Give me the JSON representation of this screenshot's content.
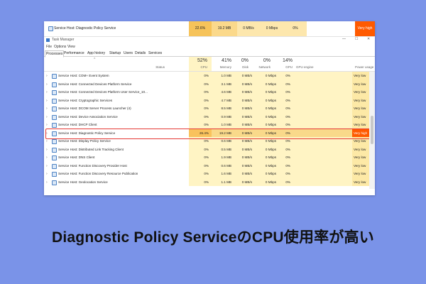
{
  "top_strip": {
    "name": "Service Host: Diagnostic Policy Service",
    "cpu": "22.6%",
    "memory": "19.2 MB",
    "disk": "0 MB/s",
    "network": "0 Mbps",
    "gpu": "0%",
    "power": "Very high"
  },
  "window": {
    "title": "Task Manager",
    "menu": [
      "File",
      "Options",
      "View"
    ],
    "tabs": [
      "Processes",
      "Performance",
      "App history",
      "Startup",
      "Users",
      "Details",
      "Services"
    ],
    "active_tab": "Processes",
    "controls": {
      "minimize": "—",
      "maximize": "☐",
      "close": "✕"
    }
  },
  "header": {
    "cpu_pct": "52%",
    "memory_pct": "41%",
    "disk_pct": "0%",
    "network_pct": "0%",
    "gpu_pct": "14%",
    "labels": {
      "status": "Status",
      "cpu": "CPU",
      "memory": "Memory",
      "disk": "Disk",
      "network": "Network",
      "gpu": "GPU",
      "gpu_engine": "GPU engine",
      "power": "Power usage"
    },
    "sort_arrow": "^"
  },
  "rows": [
    {
      "name": "Service Host: COM+ Event System",
      "cpu": "0%",
      "memory": "1.0 MB",
      "disk": "0 MB/s",
      "network": "0 Mbps",
      "gpu": "0%",
      "power": "Very low"
    },
    {
      "name": "Service Host: Connected Devices Platform Service",
      "cpu": "0%",
      "memory": "3.1 MB",
      "disk": "0 MB/s",
      "network": "0 Mbps",
      "gpu": "0%",
      "power": "Very low"
    },
    {
      "name": "Service Host: Connected Devices Platform User Service_10...",
      "cpu": "0%",
      "memory": "4.6 MB",
      "disk": "0 MB/s",
      "network": "0 Mbps",
      "gpu": "0%",
      "power": "Very low"
    },
    {
      "name": "Service Host: Cryptographic Services",
      "cpu": "0%",
      "memory": "4.7 MB",
      "disk": "0 MB/s",
      "network": "0 Mbps",
      "gpu": "0%",
      "power": "Very low"
    },
    {
      "name": "Service Host: DCOM Server Process Launcher (4)",
      "cpu": "0%",
      "memory": "8.5 MB",
      "disk": "0 MB/s",
      "network": "0 Mbps",
      "gpu": "0%",
      "power": "Very low"
    },
    {
      "name": "Service Host: Device Association Service",
      "cpu": "0%",
      "memory": "0.9 MB",
      "disk": "0 MB/s",
      "network": "0 Mbps",
      "gpu": "0%",
      "power": "Very low"
    },
    {
      "name": "Service Host: DHCP Client",
      "cpu": "0%",
      "memory": "1.0 MB",
      "disk": "0 MB/s",
      "network": "0 Mbps",
      "gpu": "0%",
      "power": "Very low"
    },
    {
      "name": "Service Host: Diagnostic Policy Service",
      "cpu": "26.4%",
      "memory": "19.2 MB",
      "disk": "0 MB/s",
      "network": "0 Mbps",
      "gpu": "0%",
      "power": "Very high",
      "selected": true
    },
    {
      "name": "Service Host: Display Policy Service",
      "cpu": "0%",
      "memory": "0.6 MB",
      "disk": "0 MB/s",
      "network": "0 Mbps",
      "gpu": "0%",
      "power": "Very low"
    },
    {
      "name": "Service Host: Distributed Link Tracking Client",
      "cpu": "0%",
      "memory": "0.5 MB",
      "disk": "0 MB/s",
      "network": "0 Mbps",
      "gpu": "0%",
      "power": "Very low"
    },
    {
      "name": "Service Host: DNS Client",
      "cpu": "0%",
      "memory": "1.9 MB",
      "disk": "0 MB/s",
      "network": "0 Mbps",
      "gpu": "0%",
      "power": "Very low"
    },
    {
      "name": "Service Host: Function Discovery Provider Host",
      "cpu": "0%",
      "memory": "0.6 MB",
      "disk": "0 MB/s",
      "network": "0 Mbps",
      "gpu": "0%",
      "power": "Very low"
    },
    {
      "name": "Service Host: Function Discovery Resource Publication",
      "cpu": "0%",
      "memory": "1.6 MB",
      "disk": "0 MB/s",
      "network": "0 Mbps",
      "gpu": "0%",
      "power": "Very low"
    },
    {
      "name": "Service Host: Geolocation Service",
      "cpu": "0%",
      "memory": "1.1 MB",
      "disk": "0 MB/s",
      "network": "0 Mbps",
      "gpu": "0%",
      "power": "Very low"
    }
  ],
  "caption": "Diagnostic Policy ServiceのCPU使用率が高い",
  "colors": {
    "background": "#7a93e8",
    "highlight": "#fff4c4",
    "high_power": "#ff5a00",
    "selection_box": "#e53935"
  }
}
